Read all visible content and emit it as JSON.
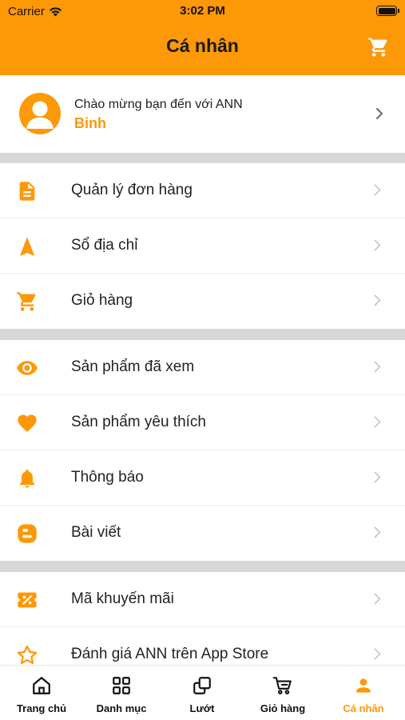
{
  "status_bar": {
    "carrier": "Carrier",
    "time": "3:02 PM"
  },
  "nav": {
    "title": "Cá nhân",
    "cart_icon": "cart-icon"
  },
  "profile": {
    "welcome": "Chào mừng bạn đến với ANN",
    "name": "Binh"
  },
  "menu": [
    {
      "label": "Quản lý đơn hàng",
      "icon": "order-document-icon"
    },
    {
      "label": "Sổ địa chỉ",
      "icon": "navigation-arrow-icon"
    },
    {
      "label": "Giỏ hàng",
      "icon": "cart-icon"
    },
    {
      "label": "Sản phẩm đã xem",
      "icon": "eye-icon"
    },
    {
      "label": "Sản phẩm yêu thích",
      "icon": "heart-icon"
    },
    {
      "label": "Thông báo",
      "icon": "bell-icon"
    },
    {
      "label": "Bài viết",
      "icon": "blogger-icon"
    },
    {
      "label": "Mã khuyến mãi",
      "icon": "coupon-icon"
    },
    {
      "label": "Đánh giá ANN trên App Store",
      "icon": "star-icon"
    }
  ],
  "tabs": [
    {
      "label": "Trang chủ",
      "icon": "home-icon",
      "active": false
    },
    {
      "label": "Danh mục",
      "icon": "grid-icon",
      "active": false
    },
    {
      "label": "Lướt",
      "icon": "copy-icon",
      "active": false
    },
    {
      "label": "Giỏ hàng",
      "icon": "cart-icon",
      "active": false
    },
    {
      "label": "Cá nhân",
      "icon": "person-icon",
      "active": true
    }
  ],
  "colors": {
    "accent": "#fd9807",
    "separator": "#d7d7d7",
    "text": "#222222"
  }
}
